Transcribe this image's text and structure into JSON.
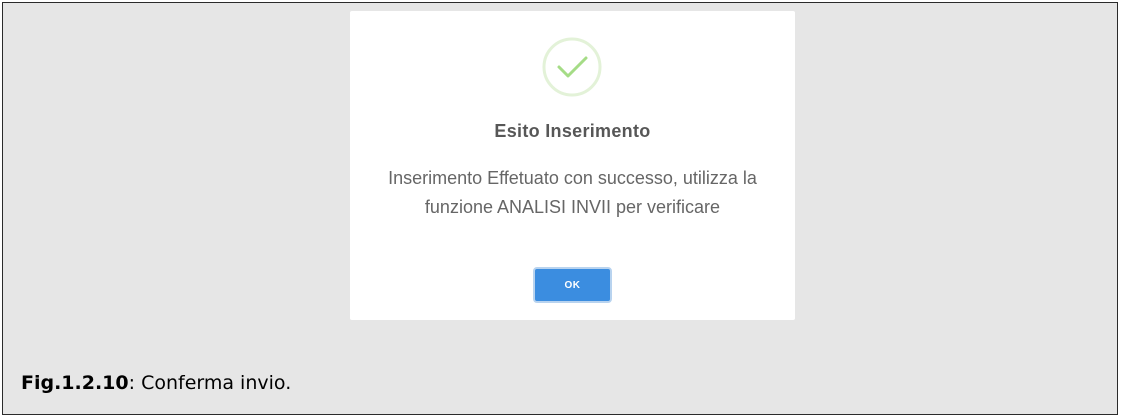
{
  "modal": {
    "icon": "check-circle-icon",
    "title": "Esito Inserimento",
    "message": "Inserimento Effetuato con successo, utilizza la funzione ANALISI INVII per verificare",
    "ok_label": "OK",
    "colors": {
      "button": "#3b8de0",
      "check": "#a5dc86"
    }
  },
  "caption": {
    "fig_number": "Fig.1.2.10",
    "text": ": Conferma invio."
  }
}
